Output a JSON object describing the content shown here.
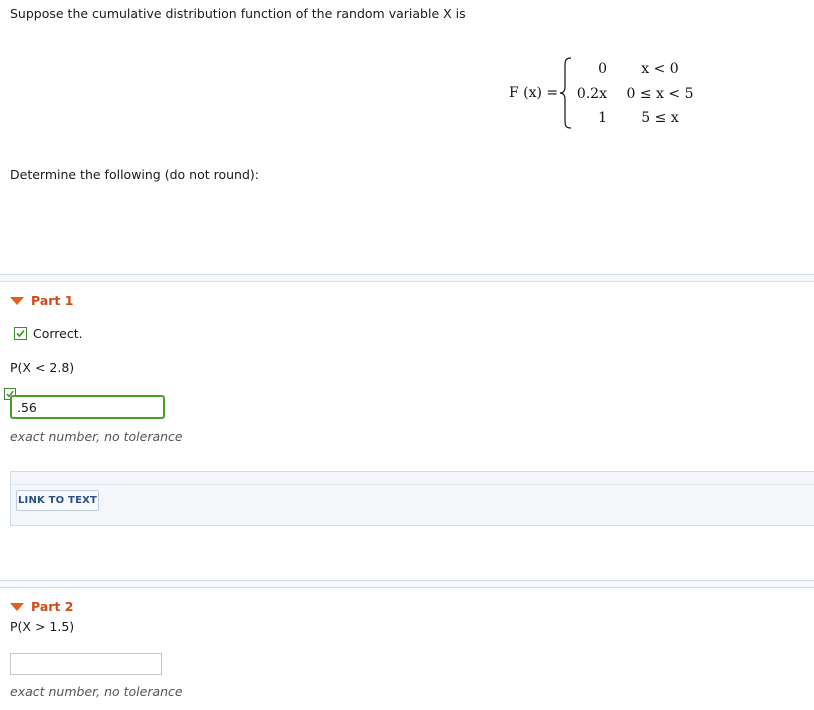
{
  "question": {
    "prompt": "Suppose the cumulative distribution function of the random variable X is",
    "function_label": "F (x) = ",
    "cases": [
      {
        "value": "0",
        "condition": "x < 0"
      },
      {
        "value": "0.2x",
        "condition": "0 ≤ x < 5"
      },
      {
        "value": "1",
        "condition": "5 ≤ x"
      }
    ],
    "instruction": "Determine the following (do not round):"
  },
  "part1": {
    "title": "Part 1",
    "status": "Correct.",
    "question": "P(X < 2.8)",
    "answer_value": ".56",
    "tolerance_note": "exact number, no tolerance",
    "link_button": "LINK TO TEXT"
  },
  "part2": {
    "title": "Part 2",
    "question": "P(X > 1.5)",
    "answer_value": "",
    "tolerance_note": "exact number, no tolerance"
  },
  "colors": {
    "part_title": "#d24a17",
    "correct_green": "#4c9c2e",
    "link_text": "#2a4f85"
  }
}
